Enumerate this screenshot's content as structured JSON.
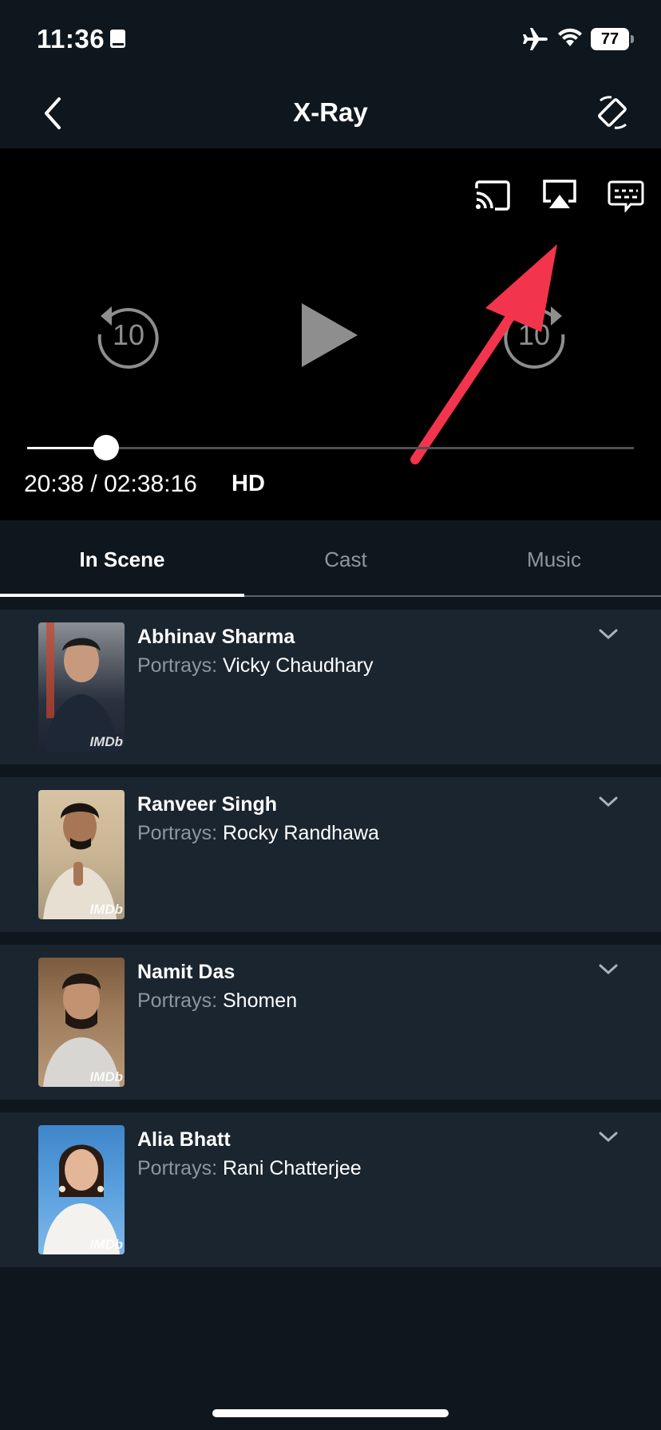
{
  "status_bar": {
    "time": "11:36",
    "battery": "77",
    "icons": [
      "book-icon",
      "airplane-icon",
      "wifi-icon",
      "battery-icon"
    ]
  },
  "header": {
    "title": "X-Ray",
    "back_icon": "chevron-left-icon",
    "rotate_icon": "rotate-screen-icon"
  },
  "player": {
    "controls": [
      "cast-icon",
      "airplay-icon",
      "subtitles-icon"
    ],
    "skip_back": "10",
    "skip_forward": "10",
    "progress_fraction": 0.13,
    "time_readout": "20:38 / 02:38:16",
    "quality": "HD",
    "annotation_color": "#f3344d"
  },
  "tabs": [
    {
      "label": "In Scene",
      "active": true
    },
    {
      "label": "Cast",
      "active": false
    },
    {
      "label": "Music",
      "active": false
    }
  ],
  "cast": [
    {
      "name": "Abhinav Sharma",
      "prefix": "Portrays:",
      "role": "Vicky Chaudhary",
      "watermark": "IMDb"
    },
    {
      "name": "Ranveer Singh",
      "prefix": "Portrays:",
      "role": "Rocky Randhawa",
      "watermark": "IMDb"
    },
    {
      "name": "Namit Das",
      "prefix": "Portrays:",
      "role": "Shomen",
      "watermark": "IMDb"
    },
    {
      "name": "Alia Bhatt",
      "prefix": "Portrays:",
      "role": "Rani Chatterjee",
      "watermark": "IMDb"
    }
  ],
  "colors": {
    "background": "#0f171e",
    "card": "#1b2530",
    "muted_text": "#8c979f"
  }
}
